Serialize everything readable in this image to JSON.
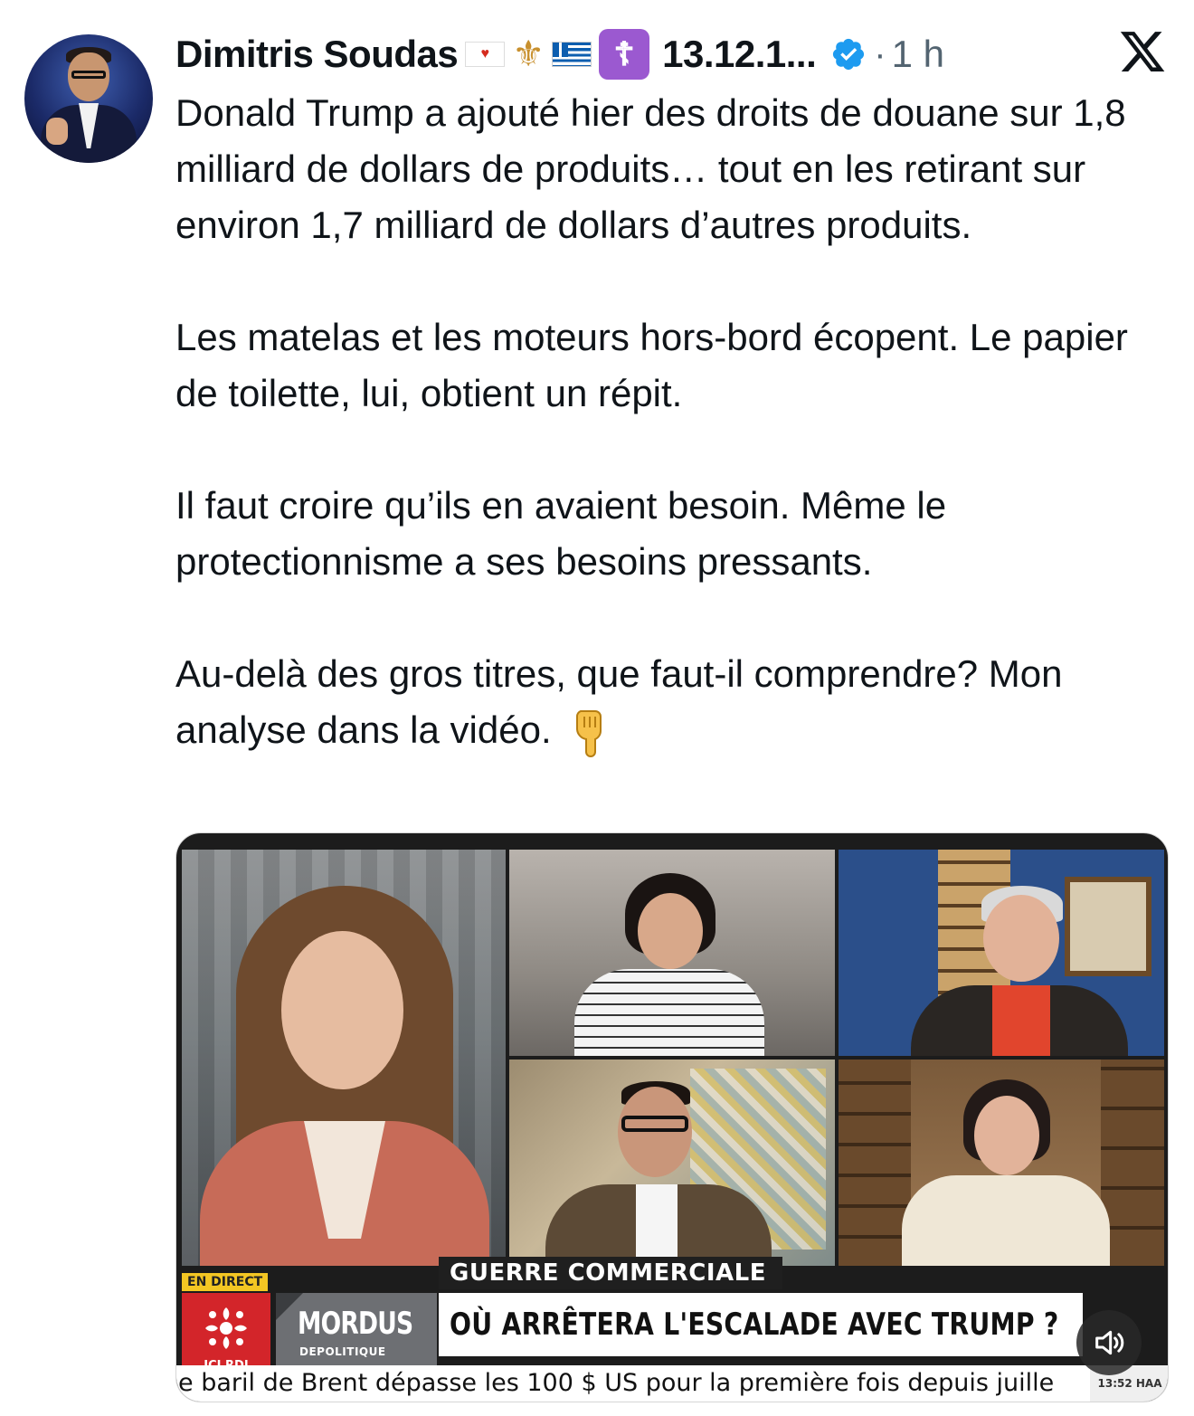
{
  "post": {
    "author_name": "Dimitris Soudas",
    "handle_truncated": "13.12.1...",
    "separator": "·",
    "time_ago": "1 h",
    "verified": true,
    "paragraphs": [
      "Donald Trump a ajouté hier des droits de douane sur 1,8 milliard de dollars de produits… tout en les retirant sur environ 1,7 milliard de dollars d’autres produits.",
      "Les matelas et les moteurs hors-bord écopent. Le papier de toilette, lui, obtient un répit.",
      "Il faut croire qu’ils en avaient besoin. Même le protectionnisme a ses besoins pressants.",
      "Au-delà des gros titres, que faut-il comprendre? Mon analyse dans la vidéo."
    ],
    "name_emojis": [
      "flag-canada-icon",
      "fleur-de-lis-icon",
      "flag-greece-icon",
      "orthodox-cross-icon"
    ],
    "trailing_emoji": "pointing-down-hand-icon"
  },
  "video": {
    "live_badge": "EN DIRECT",
    "network_label": "ICI RDI",
    "show_title": "MORDUS",
    "show_subtitle": "DEPOLITIQUE",
    "kicker": "GUERRE COMMERCIALE",
    "headline": "OÙ ARRÊTERA L'ESCALADE AVEC TRUMP ?",
    "ticker": "e baril de Brent dépasse les 100 $ US pour la première fois depuis juille",
    "clock": "13:52 HAA",
    "sound_icon": "speaker-icon"
  },
  "colors": {
    "verified_blue": "#1d9bf0",
    "text": "#0f1419",
    "muted": "#536471",
    "rdi_red": "#d3252a",
    "live_yellow": "#f3c623"
  }
}
